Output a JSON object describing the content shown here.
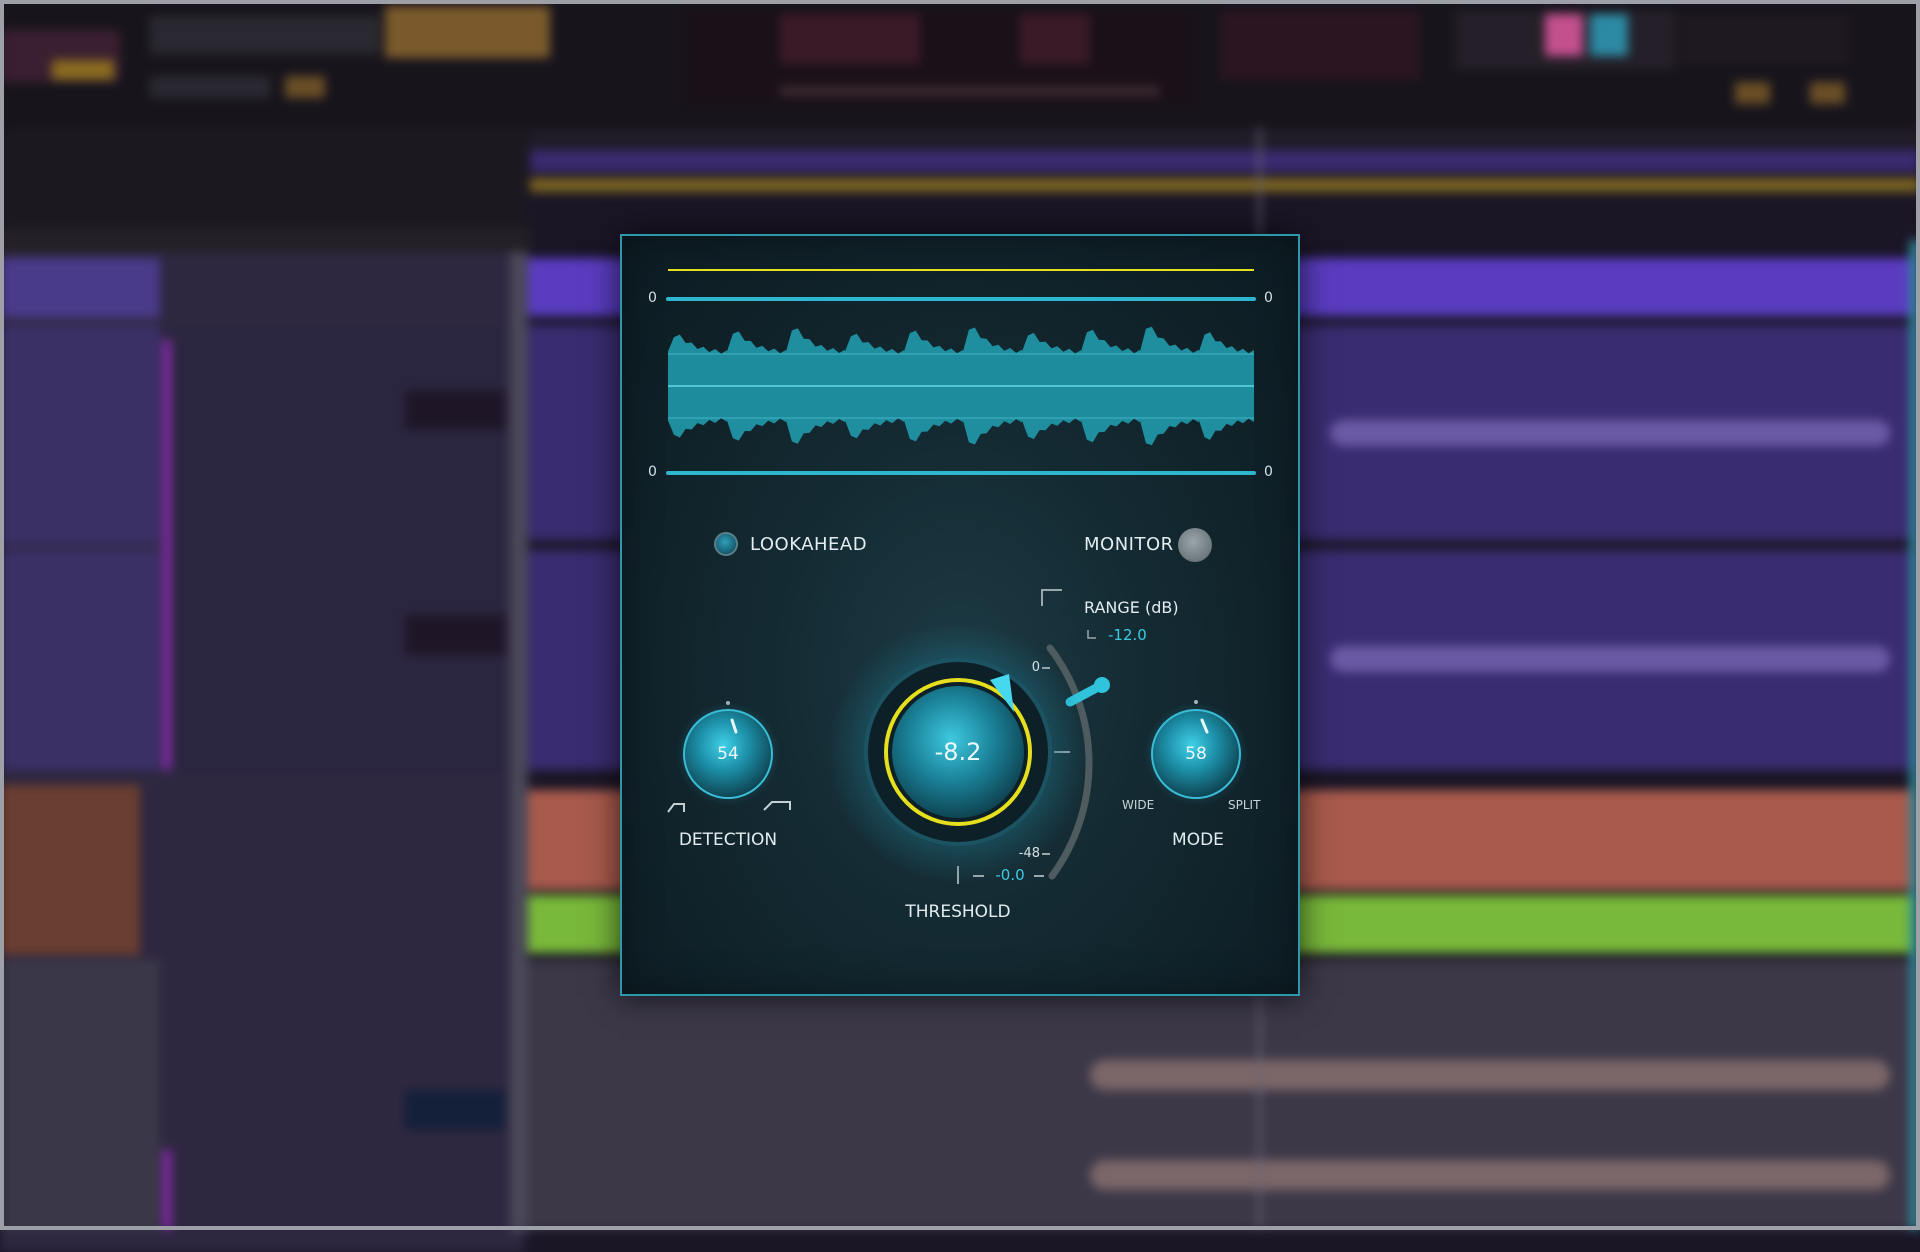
{
  "plugin": {
    "meter": {
      "top_left_label": "0",
      "top_right_label": "0",
      "bottom_left_label": "0",
      "bottom_right_label": "0"
    },
    "lookahead": {
      "label": "LOOKAHEAD",
      "enabled": true
    },
    "monitor": {
      "label": "MONITOR"
    },
    "range": {
      "label": "RANGE (dB)",
      "value": "-12.0"
    },
    "threshold": {
      "label": "THRESHOLD",
      "value": "-8.2",
      "scale_top": "0",
      "scale_bottom": "-48",
      "readout": "-0.0"
    },
    "detection": {
      "label": "DETECTION",
      "value": "54"
    },
    "mode": {
      "label": "MODE",
      "value": "58",
      "left_label": "WIDE",
      "right_label": "SPLIT"
    }
  },
  "colors": {
    "accent": "#33c6de",
    "highlight": "#e6df1e",
    "waveform": "#1f8fa0",
    "panel": "#112830"
  }
}
